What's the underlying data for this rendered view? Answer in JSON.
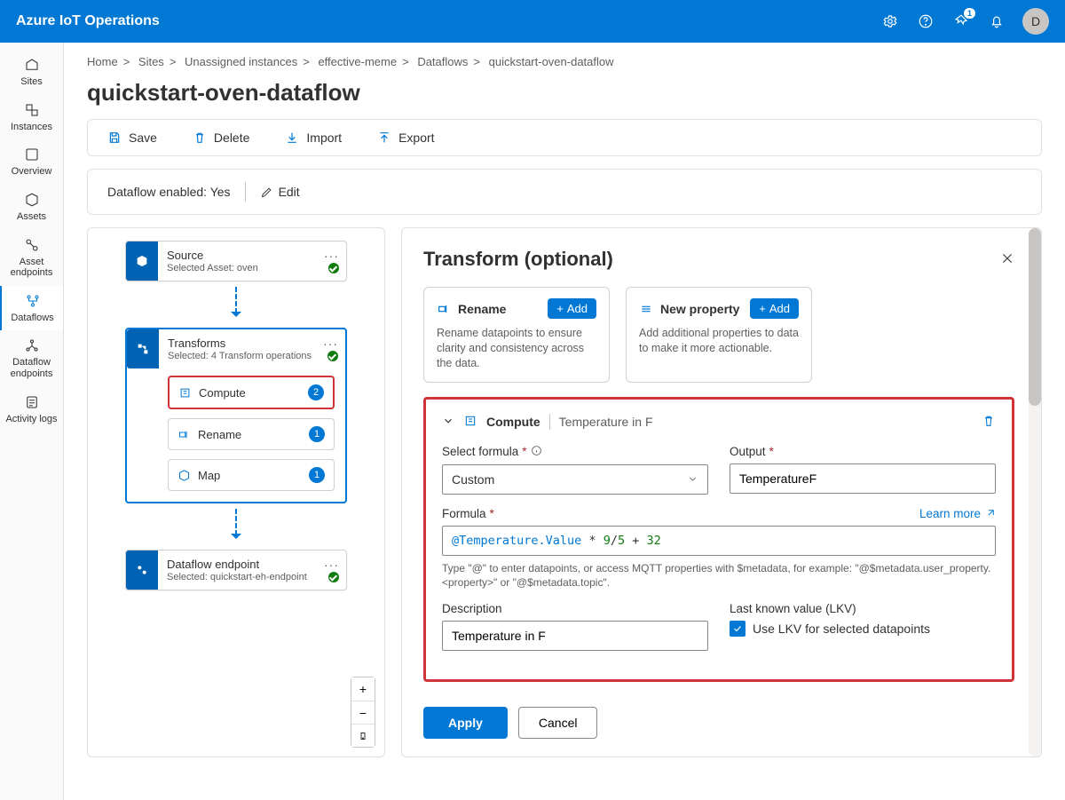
{
  "header": {
    "brand": "Azure IoT Operations",
    "notification_count": "1",
    "avatar_initial": "D"
  },
  "sidenav": {
    "items": [
      {
        "label": "Sites"
      },
      {
        "label": "Instances"
      },
      {
        "label": "Overview"
      },
      {
        "label": "Assets"
      },
      {
        "label": "Asset endpoints"
      },
      {
        "label": "Dataflows"
      },
      {
        "label": "Dataflow endpoints"
      },
      {
        "label": "Activity logs"
      }
    ]
  },
  "breadcrumb": {
    "items": [
      "Home",
      "Sites",
      "Unassigned instances",
      "effective-meme",
      "Dataflows",
      "quickstart-oven-dataflow"
    ]
  },
  "page_title": "quickstart-oven-dataflow",
  "commands": {
    "save": "Save",
    "delete": "Delete",
    "import": "Import",
    "export": "Export"
  },
  "enabled_bar": {
    "text": "Dataflow enabled: Yes",
    "edit": "Edit"
  },
  "canvas": {
    "source": {
      "title": "Source",
      "sub": "Selected Asset: oven"
    },
    "transforms": {
      "title": "Transforms",
      "sub": "Selected: 4 Transform operations",
      "ops": [
        {
          "name": "Compute",
          "count": "2"
        },
        {
          "name": "Rename",
          "count": "1"
        },
        {
          "name": "Map",
          "count": "1"
        }
      ]
    },
    "endpoint": {
      "title": "Dataflow endpoint",
      "sub": "Selected: quickstart-eh-endpoint"
    }
  },
  "panel": {
    "title": "Transform (optional)",
    "tiles": {
      "rename": {
        "title": "Rename",
        "add": "Add",
        "desc": "Rename datapoints to ensure clarity and consistency across the data."
      },
      "newprop": {
        "title": "New property",
        "add": "Add",
        "desc": "Add additional properties to data to make it more actionable."
      }
    },
    "form": {
      "section": "Compute",
      "section_sub": "Temperature in F",
      "select_formula_label": "Select formula",
      "select_formula_value": "Custom",
      "output_label": "Output",
      "output_value": "TemperatureF",
      "formula_label": "Formula",
      "learn_more": "Learn more",
      "formula_parts": {
        "p1": "@Temperature.Value",
        "op1": " * ",
        "n1": "9",
        "sl": "/",
        "n2": "5",
        "op2": " + ",
        "n3": "32"
      },
      "hint": "Type \"@\" to enter datapoints, or access MQTT properties with $metadata, for example: \"@$metadata.user_property.<property>\" or \"@$metadata.topic\".",
      "description_label": "Description",
      "description_value": "Temperature in F",
      "lkv_label": "Last known value (LKV)",
      "lkv_checkbox": "Use LKV for selected datapoints"
    },
    "footer": {
      "apply": "Apply",
      "cancel": "Cancel"
    }
  }
}
